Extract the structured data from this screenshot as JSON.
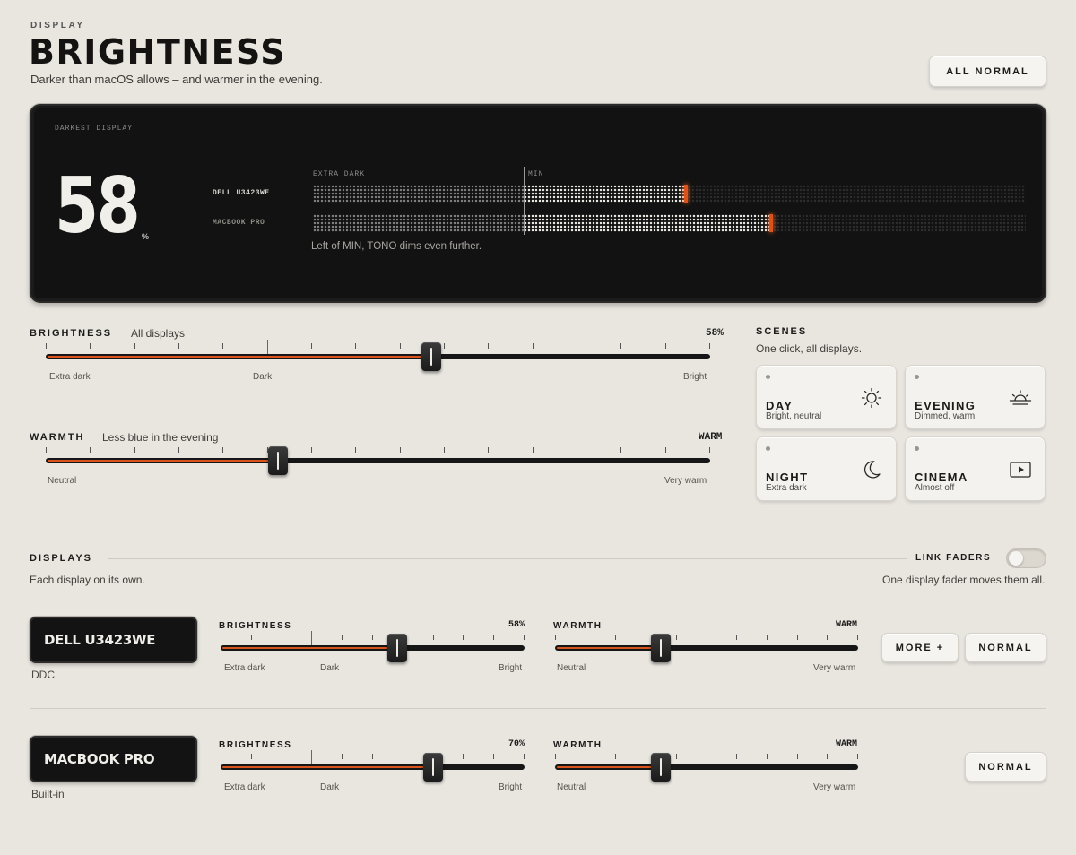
{
  "header": {
    "eyebrow": "DISPLAY",
    "title": "BRIGHTNESS",
    "subtitle": "Darker than macOS allows – and warmer in the evening.",
    "all_normal_label": "ALL NORMAL"
  },
  "panel": {
    "label": "DARKEST DISPLAY",
    "value": "58",
    "unit": "%",
    "zone_extra": "EXTRA DARK",
    "zone_min": "MIN",
    "note": "Left of MIN, TONO dims even further.",
    "displays": [
      {
        "name": "DELL U3423WE",
        "level": 0.58
      },
      {
        "name": "MACBOOK PRO",
        "level": 0.7
      }
    ]
  },
  "brightness": {
    "label": "BRIGHTNESS",
    "sub": "All displays",
    "value_text": "58%",
    "value": 0.58,
    "left": "Extra dark",
    "mid": "Dark",
    "right": "Bright"
  },
  "warmth": {
    "label": "WARMTH",
    "sub": "Less blue in the evening",
    "value_text": "WARM",
    "value": 0.35,
    "left": "Neutral",
    "right": "Very warm"
  },
  "scenes": {
    "title": "SCENES",
    "sub": "One click, all displays.",
    "items": [
      {
        "name": "DAY",
        "desc": "Bright, neutral",
        "icon": "sun-icon"
      },
      {
        "name": "EVENING",
        "desc": "Dimmed, warm",
        "icon": "sunset-icon"
      },
      {
        "name": "NIGHT",
        "desc": "Extra dark",
        "icon": "moon-icon"
      },
      {
        "name": "CINEMA",
        "desc": "Almost off",
        "icon": "play-icon"
      }
    ]
  },
  "displays": {
    "title": "DISPLAYS",
    "sub": "Each display on its own.",
    "link_label": "LINK FADERS",
    "link_sub": "One display fader moves them all.",
    "link_on": false,
    "items": [
      {
        "name": "DELL U3423WE",
        "kind": "DDC",
        "brightness_label": "BRIGHTNESS",
        "brightness_text": "58%",
        "brightness": 0.58,
        "b_left": "Extra dark",
        "b_mid": "Dark",
        "b_right": "Bright",
        "warmth_label": "WARMTH",
        "warmth_text": "WARM",
        "warmth": 0.35,
        "w_left": "Neutral",
        "w_right": "Very warm",
        "more_label": "MORE  +",
        "normal_label": "NORMAL"
      },
      {
        "name": "MACBOOK PRO",
        "kind": "Built-in",
        "brightness_label": "BRIGHTNESS",
        "brightness_text": "70%",
        "brightness": 0.7,
        "b_left": "Extra dark",
        "b_mid": "Dark",
        "b_right": "Bright",
        "warmth_label": "WARMTH",
        "warmth_text": "WARM",
        "warmth": 0.35,
        "w_left": "Neutral",
        "w_right": "Very warm",
        "normal_label": "NORMAL"
      }
    ]
  },
  "colors": {
    "accent": "#d9531c",
    "background": "#e9e6e0",
    "panel": "#121212"
  }
}
